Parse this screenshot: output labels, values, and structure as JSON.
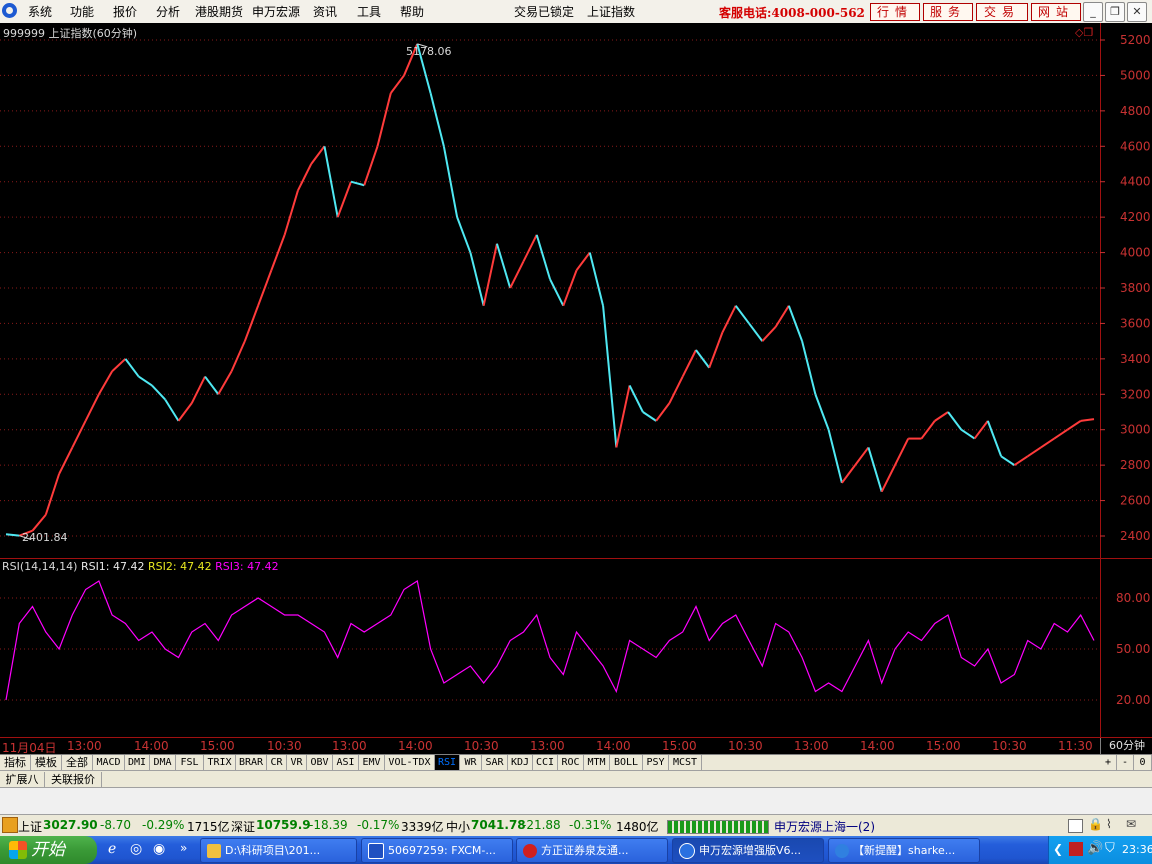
{
  "menu": {
    "items": [
      "系统",
      "功能",
      "报价",
      "分析",
      "港股期货",
      "申万宏源",
      "资讯",
      "工具",
      "帮助"
    ],
    "lock_status": "交易已锁定",
    "current_index": "上证指数",
    "hotline": "客服电话:4008-000-562",
    "buttons": [
      "行情",
      "服务",
      "交易",
      "网站"
    ]
  },
  "chart": {
    "title": "999999 上证指数(60分钟)",
    "high_label": "5178.06",
    "low_label": "2401.84",
    "price_axis": [
      "5200",
      "5000",
      "4800",
      "4600",
      "4400",
      "4200",
      "4000",
      "3800",
      "3600",
      "3400",
      "3200",
      "3000",
      "2800",
      "2600",
      "2400"
    ],
    "rsi_title": "RSI(14,14,14)",
    "rsi1": "RSI1: 47.42",
    "rsi2": "RSI2: 47.42",
    "rsi3": "RSI3: 47.42",
    "rsi_axis": [
      "80.00",
      "50.00",
      "20.00"
    ],
    "time_labels": [
      "11月04日",
      "13:00",
      "14:00",
      "15:00",
      "10:30",
      "13:00",
      "14:00",
      "10:30",
      "13:00",
      "14:00",
      "15:00",
      "10:30",
      "13:00",
      "14:00",
      "15:00",
      "10:30",
      "11:30"
    ],
    "period": "60分钟",
    "colors": {
      "up": "#ff3b3b",
      "down": "#4fe8f2",
      "rsi": "#ff00ff",
      "axis": "#c83232",
      "grid": "#8a1a1a"
    }
  },
  "chart_data": {
    "type": "line",
    "title": "999999 上证指数(60分钟)",
    "ylim": [
      2300,
      5250
    ],
    "series": [
      {
        "name": "上证指数",
        "values": [
          2410,
          2402,
          2430,
          2520,
          2750,
          2900,
          3050,
          3200,
          3330,
          3400,
          3300,
          3250,
          3170,
          3050,
          3150,
          3300,
          3200,
          3330,
          3500,
          3700,
          3900,
          4100,
          4350,
          4500,
          4600,
          4200,
          4400,
          4380,
          4600,
          4900,
          5000,
          5178,
          4900,
          4600,
          4200,
          4000,
          3700,
          4050,
          3800,
          3950,
          4100,
          3850,
          3700,
          3900,
          4000,
          3700,
          2900,
          3250,
          3100,
          3050,
          3150,
          3300,
          3450,
          3350,
          3550,
          3700,
          3600,
          3500,
          3580,
          3700,
          3500,
          3200,
          3000,
          2700,
          2800,
          2900,
          2650,
          2800,
          2950,
          2950,
          3050,
          3100,
          3000,
          2950,
          3050,
          2850,
          2800,
          2850,
          2900,
          2950,
          3000,
          3050,
          3060
        ]
      },
      {
        "name": "RSI",
        "values": [
          20,
          65,
          75,
          60,
          50,
          70,
          85,
          90,
          70,
          65,
          55,
          60,
          50,
          45,
          60,
          65,
          55,
          70,
          75,
          80,
          75,
          70,
          70,
          65,
          60,
          45,
          65,
          60,
          65,
          70,
          85,
          90,
          50,
          30,
          35,
          40,
          30,
          40,
          55,
          60,
          70,
          45,
          35,
          60,
          50,
          40,
          25,
          55,
          50,
          45,
          55,
          60,
          75,
          55,
          65,
          70,
          55,
          40,
          65,
          60,
          45,
          25,
          30,
          25,
          40,
          55,
          30,
          50,
          60,
          55,
          65,
          70,
          45,
          40,
          50,
          30,
          35,
          55,
          50,
          65,
          60,
          70,
          55
        ]
      }
    ]
  },
  "tabs": {
    "items": [
      "指标",
      "模板",
      "全部",
      "MACD",
      "DMI",
      "DMA",
      "FSL",
      "TRIX",
      "BRAR",
      "CR",
      "VR",
      "OBV",
      "ASI",
      "EMV",
      "VOL-TDX",
      "RSI",
      "WR",
      "SAR",
      "KDJ",
      "CCI",
      "ROC",
      "MTM",
      "BOLL",
      "PSY",
      "MCST"
    ],
    "active": "RSI",
    "row2": [
      "扩展八",
      "关联报价"
    ],
    "controls": [
      "+",
      "-",
      "0"
    ]
  },
  "status": {
    "sh_label": "上证",
    "sh_value": "3027.90",
    "sh_change": "-8.70",
    "sh_pct": "-0.29%",
    "sh_amount": "1715亿",
    "sz_label": "深证",
    "sz_value": "10759.9",
    "sz_change": "-18.39",
    "sz_pct": "-0.17%",
    "sz_amount": "3339亿",
    "zx_label": "中小",
    "zx_value": "7041.78",
    "zx_change": "-21.88",
    "zx_pct": "-0.31%",
    "zx_amount": "1480亿",
    "server": "申万宏源上海一(2)"
  },
  "taskbar": {
    "start": "开始",
    "tasks": [
      "D:\\科研项目\\201...",
      "50697259: FXCM-...",
      "方正证券泉友通...",
      "申万宏源增强版V6...",
      "【新提醒】sharke..."
    ],
    "clock": "23:36"
  }
}
